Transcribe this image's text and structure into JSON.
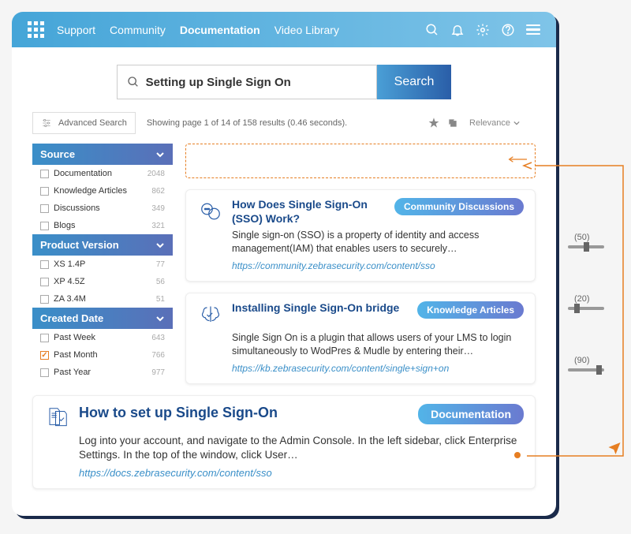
{
  "nav": {
    "items": [
      {
        "label": "Support"
      },
      {
        "label": "Community"
      },
      {
        "label": "Documentation",
        "active": true
      },
      {
        "label": "Video Library"
      }
    ]
  },
  "search": {
    "value": "Setting up Single Sign On",
    "button": "Search"
  },
  "advanced_label": "Advanced Search",
  "results_meta": "Showing page 1 of 14 of 158 results (0.46 seconds).",
  "sort_label": "Relevance",
  "facets": [
    {
      "title": "Source",
      "items": [
        {
          "label": "Documentation",
          "count": "2048",
          "checked": false
        },
        {
          "label": "Knowledge Articles",
          "count": "862",
          "checked": false
        },
        {
          "label": "Discussions",
          "count": "349",
          "checked": false
        },
        {
          "label": "Blogs",
          "count": "321",
          "checked": false
        }
      ]
    },
    {
      "title": "Product Version",
      "items": [
        {
          "label": "XS 1.4P",
          "count": "77",
          "checked": false
        },
        {
          "label": "XP 4.5Z",
          "count": "56",
          "checked": false
        },
        {
          "label": "ZA 3.4M",
          "count": "51",
          "checked": false
        }
      ]
    },
    {
      "title": "Created Date",
      "items": [
        {
          "label": "Past Week",
          "count": "643",
          "checked": false
        },
        {
          "label": "Past Month",
          "count": "766",
          "checked": true
        },
        {
          "label": "Past Year",
          "count": "977",
          "checked": false
        }
      ]
    }
  ],
  "results": [
    {
      "title": "How Does Single Sign-On (SSO) Work?",
      "badge": "Community Discussions",
      "body": "Single sign-on (SSO) is a property of identity and access management(IAM) that enables users to securely…",
      "url": "https://community.zebrasecurity.com/content/sso",
      "icon": "chat"
    },
    {
      "title": "Installing Single Sign-On bridge",
      "badge": "Knowledge Articles",
      "body": "Single Sign On is a plugin that allows users of your LMS to login simultaneously to WodPres & Mudle by entering their…",
      "url": "https://kb.zebrasecurity.com/content/single+sign+on",
      "icon": "brain"
    },
    {
      "title": "How to set up Single Sign-On",
      "badge": "Documentation",
      "body": "Log into your account, and navigate to the Admin Console. In the left sidebar, click Enterprise Settings. In the top of the window, click User…",
      "url": "https://docs.zebrasecurity.com/content/sso",
      "icon": "docs",
      "wide": true
    }
  ],
  "sliders": [
    {
      "label": "(50)",
      "pos": 50
    },
    {
      "label": "(20)",
      "pos": 20
    },
    {
      "label": "(90)",
      "pos": 90
    }
  ]
}
